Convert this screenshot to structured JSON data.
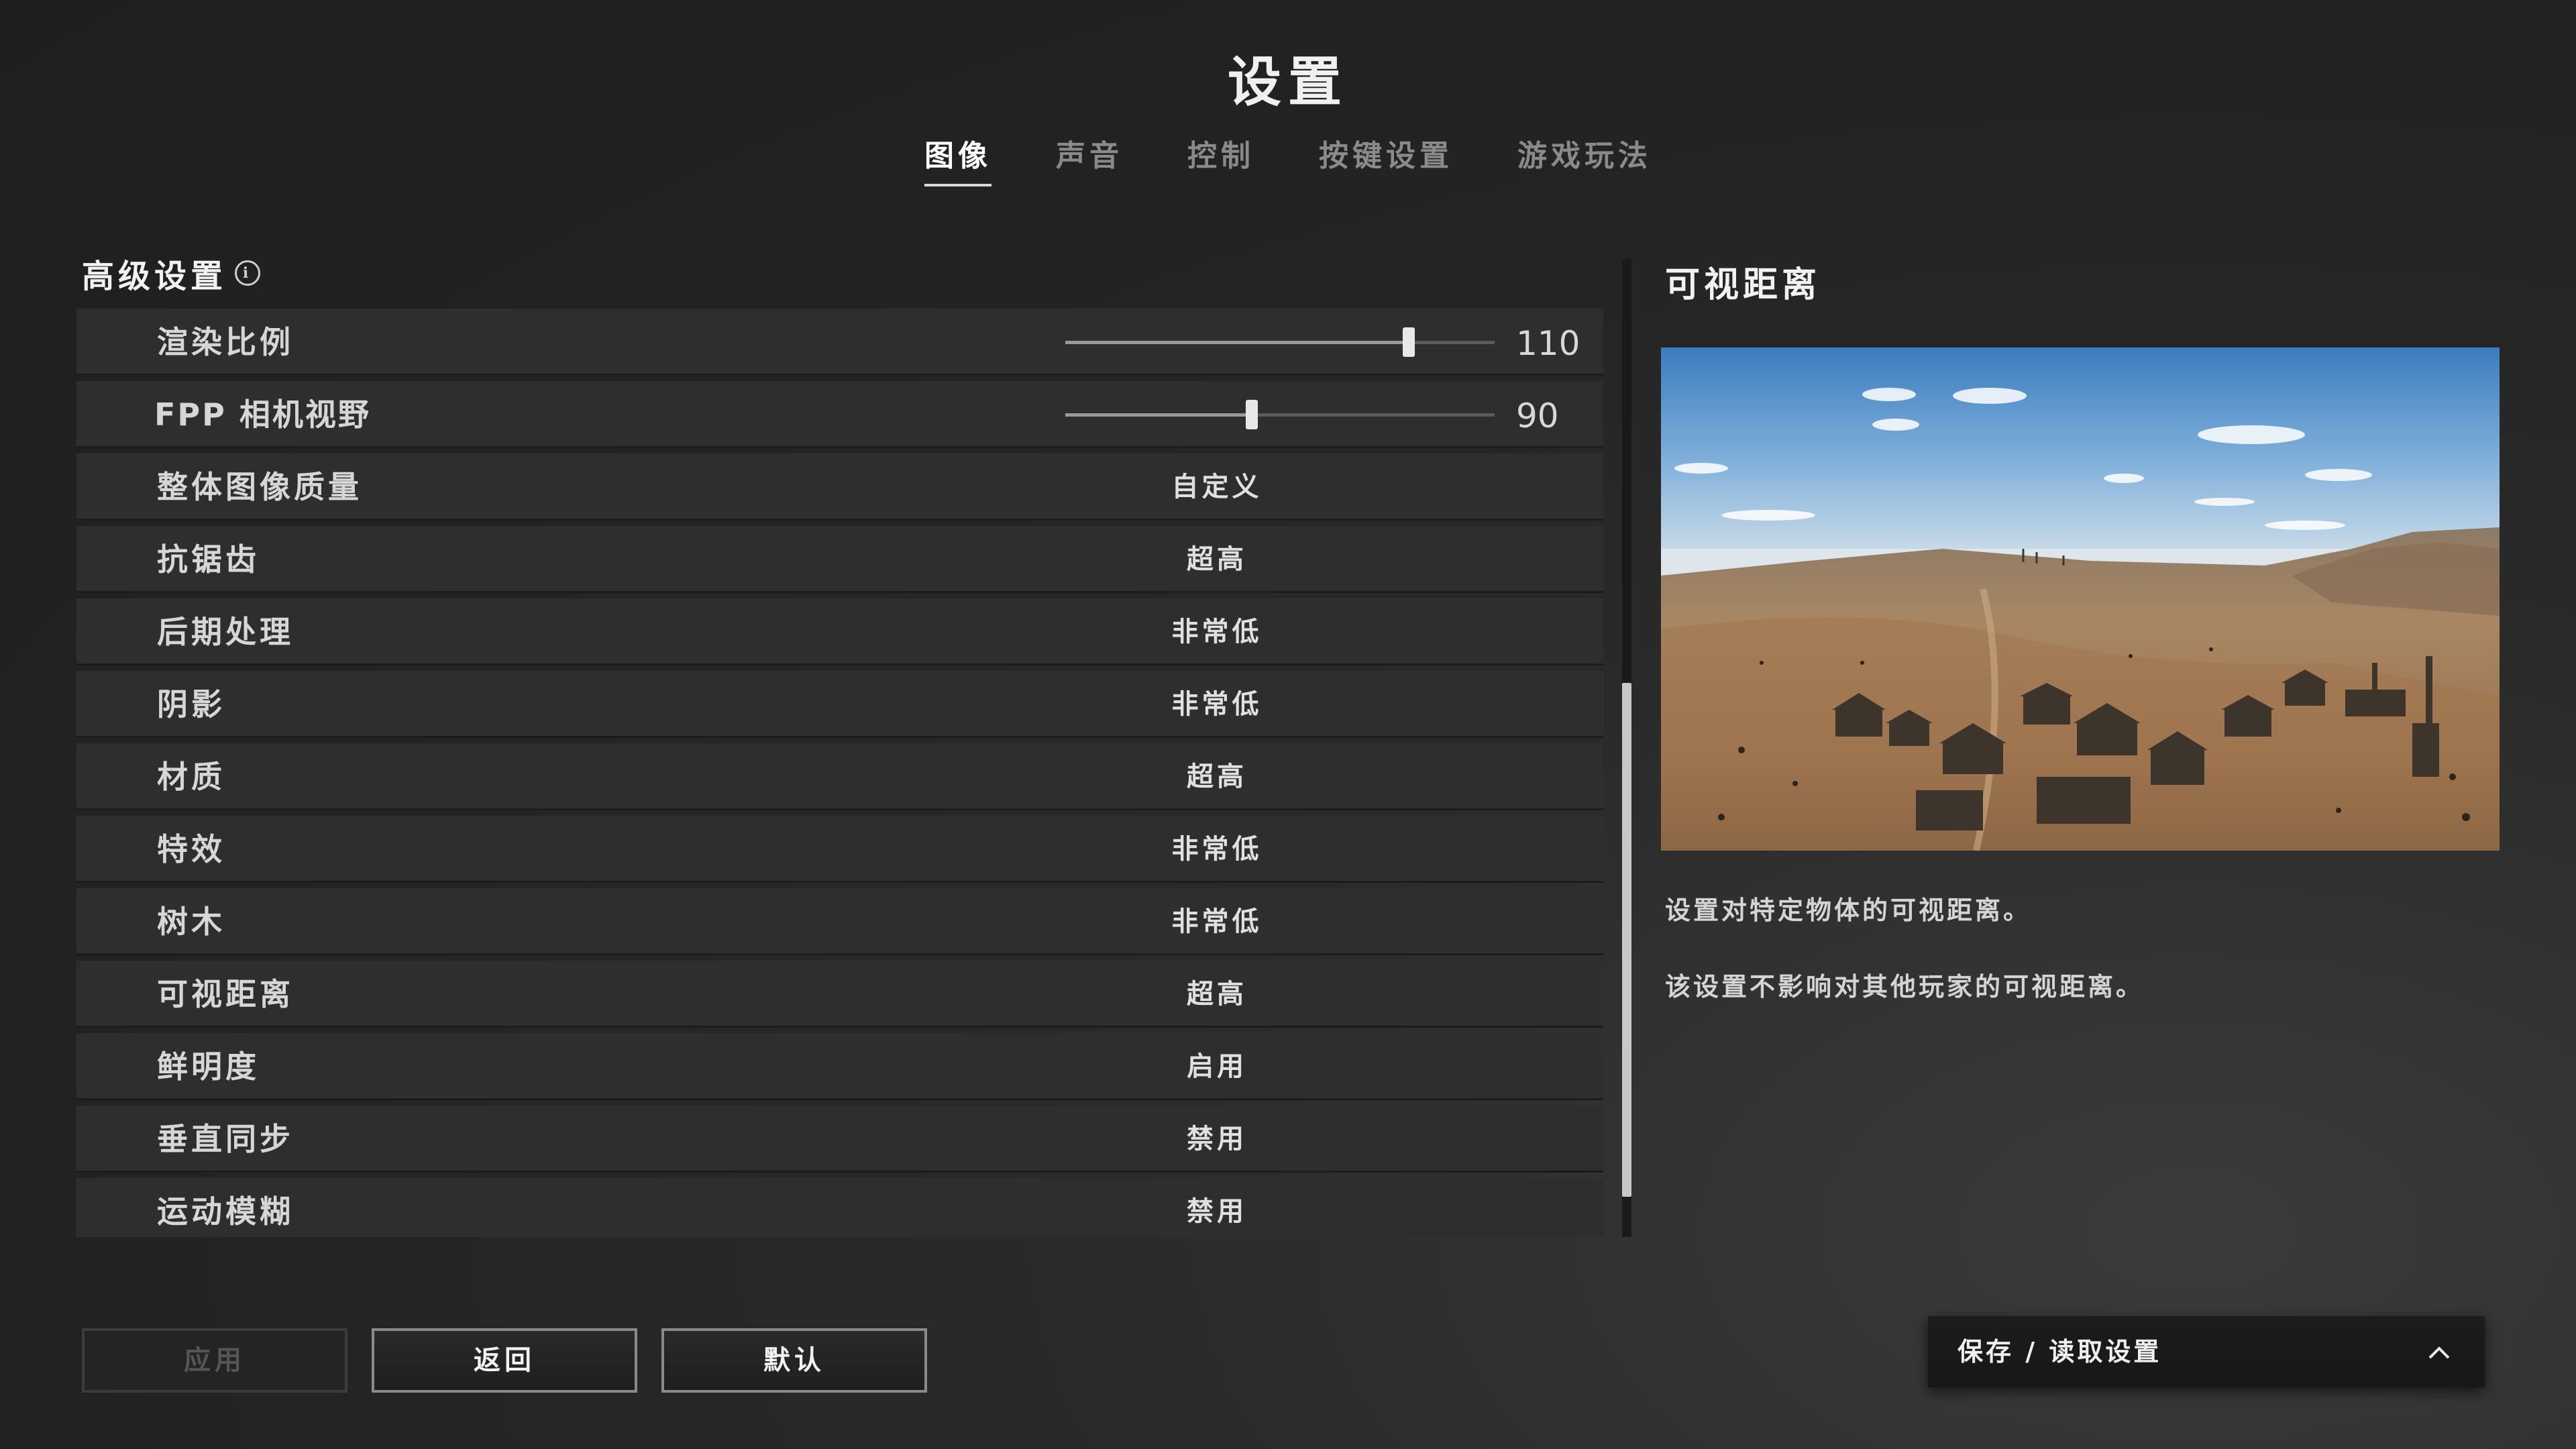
{
  "header": {
    "title": "设置",
    "tabs": [
      {
        "label": "图像",
        "active": true
      },
      {
        "label": "声音",
        "active": false
      },
      {
        "label": "控制",
        "active": false
      },
      {
        "label": "按键设置",
        "active": false
      },
      {
        "label": "游戏玩法",
        "active": false
      }
    ]
  },
  "advanced": {
    "title": "高级设置",
    "info_icon": "info-icon",
    "render_scale": {
      "label": "渲染比例",
      "value": "110",
      "min": 70,
      "max": 120,
      "current": 110
    },
    "fpp_fov": {
      "label": "FPP 相机视野",
      "value": "90",
      "min": 80,
      "max": 103,
      "current": 90
    },
    "rows": [
      {
        "label": "整体图像质量",
        "value": "自定义"
      },
      {
        "label": "抗锯齿",
        "value": "超高"
      },
      {
        "label": "后期处理",
        "value": "非常低"
      },
      {
        "label": "阴影",
        "value": "非常低"
      },
      {
        "label": "材质",
        "value": "超高"
      },
      {
        "label": "特效",
        "value": "非常低"
      },
      {
        "label": "树木",
        "value": "非常低"
      },
      {
        "label": "可视距离",
        "value": "超高"
      },
      {
        "label": "鲜明度",
        "value": "启用"
      },
      {
        "label": "垂直同步",
        "value": "禁用"
      },
      {
        "label": "运动模糊",
        "value": "禁用"
      }
    ]
  },
  "detail": {
    "title": "可视距离",
    "desc1": "设置对特定物体的可视距离。",
    "desc2": "该设置不影响对其他玩家的可视距离。"
  },
  "footer": {
    "apply": "应用",
    "back": "返回",
    "default": "默认",
    "save_load": "保存 / 读取设置",
    "save_load_icon": "chevron-up-icon"
  }
}
